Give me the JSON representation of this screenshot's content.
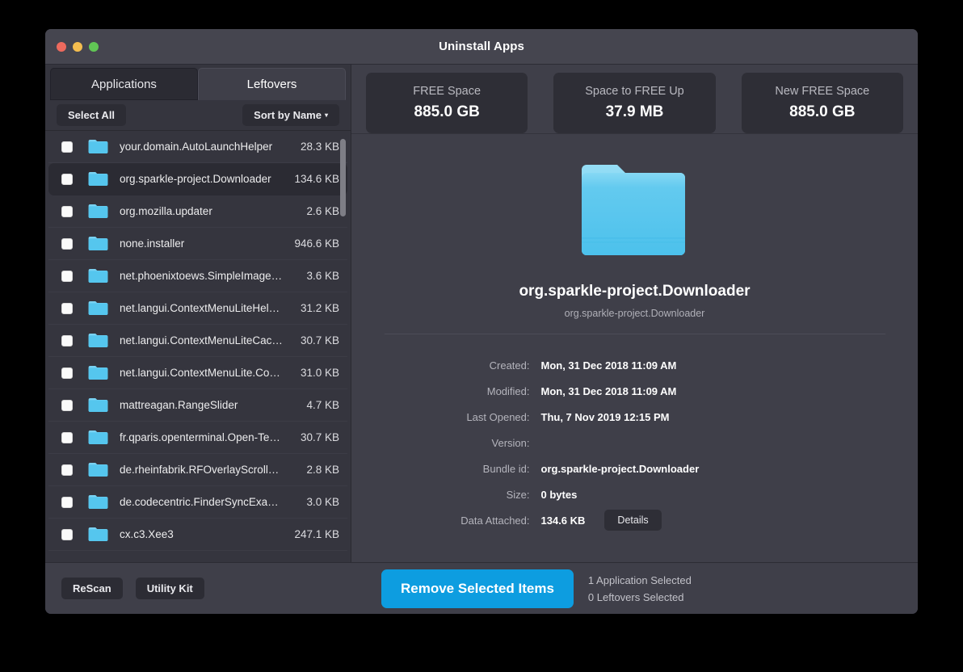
{
  "window": {
    "title": "Uninstall Apps",
    "traffic_lights": [
      "close-button",
      "minimize-button",
      "maximize-button"
    ]
  },
  "left_pane": {
    "tabs": [
      {
        "label": "Applications",
        "active": false
      },
      {
        "label": "Leftovers",
        "active": true
      }
    ],
    "toolbar": {
      "select_all_label": "Select All",
      "sort_label": "Sort by Name",
      "sort_caret": "▾"
    },
    "items": [
      {
        "name": "your.domain.AutoLaunchHelper",
        "size": "28.3 KB",
        "checked": false,
        "selected": false
      },
      {
        "name": "org.sparkle-project.Downloader",
        "size": "134.6 KB",
        "checked": false,
        "selected": true
      },
      {
        "name": "org.mozilla.updater",
        "size": "2.6 KB",
        "checked": false,
        "selected": false
      },
      {
        "name": "none.installer",
        "size": "946.6 KB",
        "checked": false,
        "selected": false
      },
      {
        "name": "net.phoenixtoews.SimpleImage…",
        "size": "3.6 KB",
        "checked": false,
        "selected": false
      },
      {
        "name": "net.langui.ContextMenuLiteHel…",
        "size": "31.2 KB",
        "checked": false,
        "selected": false
      },
      {
        "name": "net.langui.ContextMenuLiteCac…",
        "size": "30.7 KB",
        "checked": false,
        "selected": false
      },
      {
        "name": "net.langui.ContextMenuLite.Co…",
        "size": "31.0 KB",
        "checked": false,
        "selected": false
      },
      {
        "name": "mattreagan.RangeSlider",
        "size": "4.7 KB",
        "checked": false,
        "selected": false
      },
      {
        "name": "fr.qparis.openterminal.Open-Te…",
        "size": "30.7 KB",
        "checked": false,
        "selected": false
      },
      {
        "name": "de.rheinfabrik.RFOverlayScroll…",
        "size": "2.8 KB",
        "checked": false,
        "selected": false
      },
      {
        "name": "de.codecentric.FinderSyncExa…",
        "size": "3.0 KB",
        "checked": false,
        "selected": false
      },
      {
        "name": "cx.c3.Xee3",
        "size": "247.1 KB",
        "checked": false,
        "selected": false
      }
    ]
  },
  "stats_cards": [
    {
      "label": "FREE Space",
      "value": "885.0 GB"
    },
    {
      "label": "Space to FREE Up",
      "value": "37.9 MB"
    },
    {
      "label": "New FREE Space",
      "value": "885.0 GB"
    }
  ],
  "detail": {
    "icon": "folder-icon",
    "title": "org.sparkle-project.Downloader",
    "subtitle": "org.sparkle-project.Downloader",
    "fields": [
      {
        "label": "Created:",
        "value": "Mon, 31 Dec 2018 11:09 AM"
      },
      {
        "label": "Modified:",
        "value": "Mon, 31 Dec 2018 11:09 AM"
      },
      {
        "label": "Last Opened:",
        "value": "Thu, 7 Nov 2019 12:15 PM"
      },
      {
        "label": "Version:",
        "value": ""
      },
      {
        "label": "Bundle id:",
        "value": "org.sparkle-project.Downloader"
      },
      {
        "label": "Size:",
        "value": "0 bytes"
      },
      {
        "label": "Data Attached:",
        "value": "134.6 KB"
      }
    ],
    "details_button_label": "Details"
  },
  "footer": {
    "rescan_label": "ReScan",
    "utility_kit_label": "Utility Kit",
    "remove_label": "Remove Selected Items",
    "status_line_1": "1 Application Selected",
    "status_line_2": "0 Leftovers Selected"
  },
  "colors": {
    "accent_blue": "#0d9de0",
    "folder_blue": "#5ec8ee",
    "window_bg": "#35353e",
    "panel_bg": "#3f3f49",
    "card_bg": "#2e2e36",
    "close": "#ed6a5e",
    "minimize": "#f4bd4f",
    "maximize": "#61c555"
  }
}
